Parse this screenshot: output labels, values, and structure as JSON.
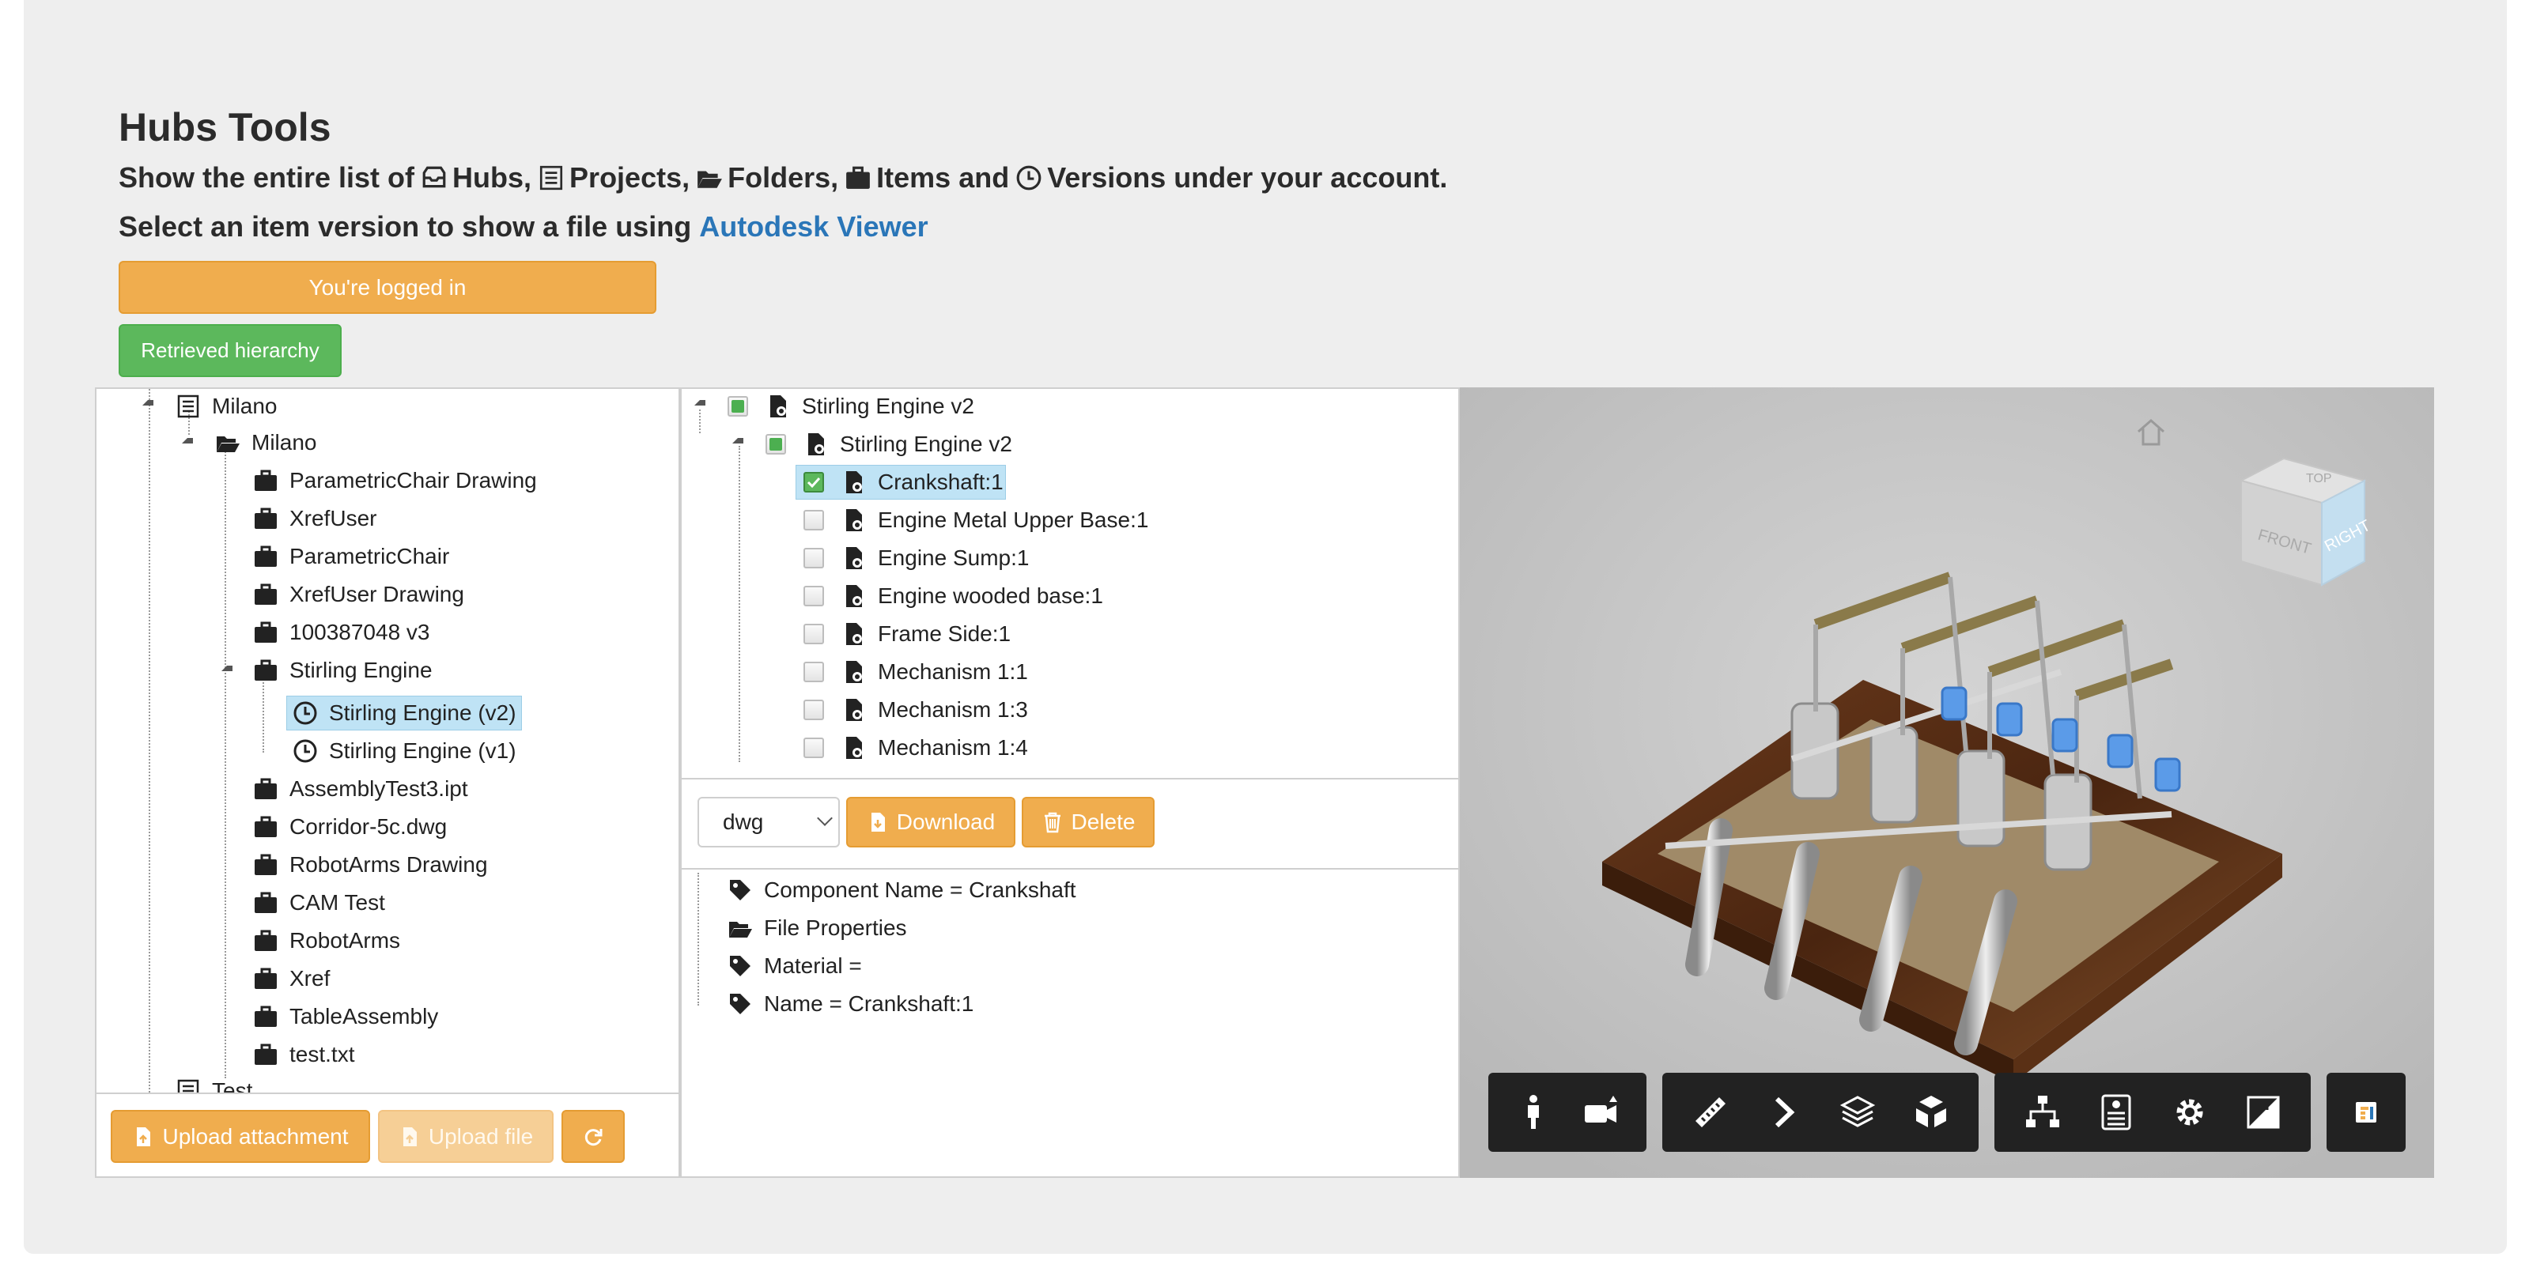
{
  "header": {
    "title": "Hubs Tools",
    "line1": {
      "pre": "Show the entire list of",
      "hubs": "Hubs,",
      "projects": "Projects,",
      "folders": "Folders,",
      "items": "Items and",
      "versions": "Versions under your account."
    },
    "line2": {
      "pre": "Select an item version to show a file using",
      "link": "Autodesk Viewer"
    },
    "logged_in": "You're logged in",
    "retrieved": "Retrieved hierarchy"
  },
  "left_tree": {
    "project": "Milano",
    "folder": "Milano",
    "items": [
      "ParametricChair Drawing",
      "XrefUser",
      "ParametricChair",
      "XrefUser Drawing",
      "100387048 v3",
      "Stirling Engine"
    ],
    "versions": [
      "Stirling Engine (v2)",
      "Stirling Engine (v1)"
    ],
    "items_after": [
      "AssemblyTest3.ipt",
      "Corridor-5c.dwg",
      "RobotArms Drawing",
      "CAM Test",
      "RobotArms",
      "Xref",
      "TableAssembly",
      "test.txt"
    ],
    "next_project": "Test",
    "upload_attachment": "Upload attachment",
    "upload_file": "Upload file"
  },
  "component_tree": {
    "root": "Stirling Engine v2",
    "child": "Stirling Engine v2",
    "components": [
      "Crankshaft:1",
      "Engine Metal Upper Base:1",
      "Engine Sump:1",
      "Engine wooded base:1",
      "Frame Side:1",
      "Mechanism 1:1",
      "Mechanism 1:3",
      "Mechanism 1:4"
    ],
    "format": "dwg",
    "download": "Download",
    "delete": "Delete"
  },
  "properties": [
    {
      "icon": "tag-icon",
      "text": "Component Name = Crankshaft"
    },
    {
      "icon": "folder-icon",
      "text": "File Properties"
    },
    {
      "icon": "tag-icon",
      "text": "Material ="
    },
    {
      "icon": "tag-icon",
      "text": "Name = Crankshaft:1"
    }
  ],
  "viewer": {
    "viewcube": {
      "top": "TOP",
      "front": "FRONT",
      "right": "RIGHT"
    },
    "toolbar": [
      [
        "walk-icon",
        "camera-icon"
      ],
      [
        "measure-icon",
        "section-icon",
        "layers-icon",
        "explode-icon"
      ],
      [
        "model-browser-icon",
        "properties-icon",
        "settings-icon",
        "fullscreen-icon"
      ],
      [
        "extension-icon"
      ]
    ]
  },
  "colors": {
    "accent": "#f0ad4e",
    "success": "#5cb85c",
    "link": "#2a76b8",
    "selection": "#bfe3f5"
  }
}
